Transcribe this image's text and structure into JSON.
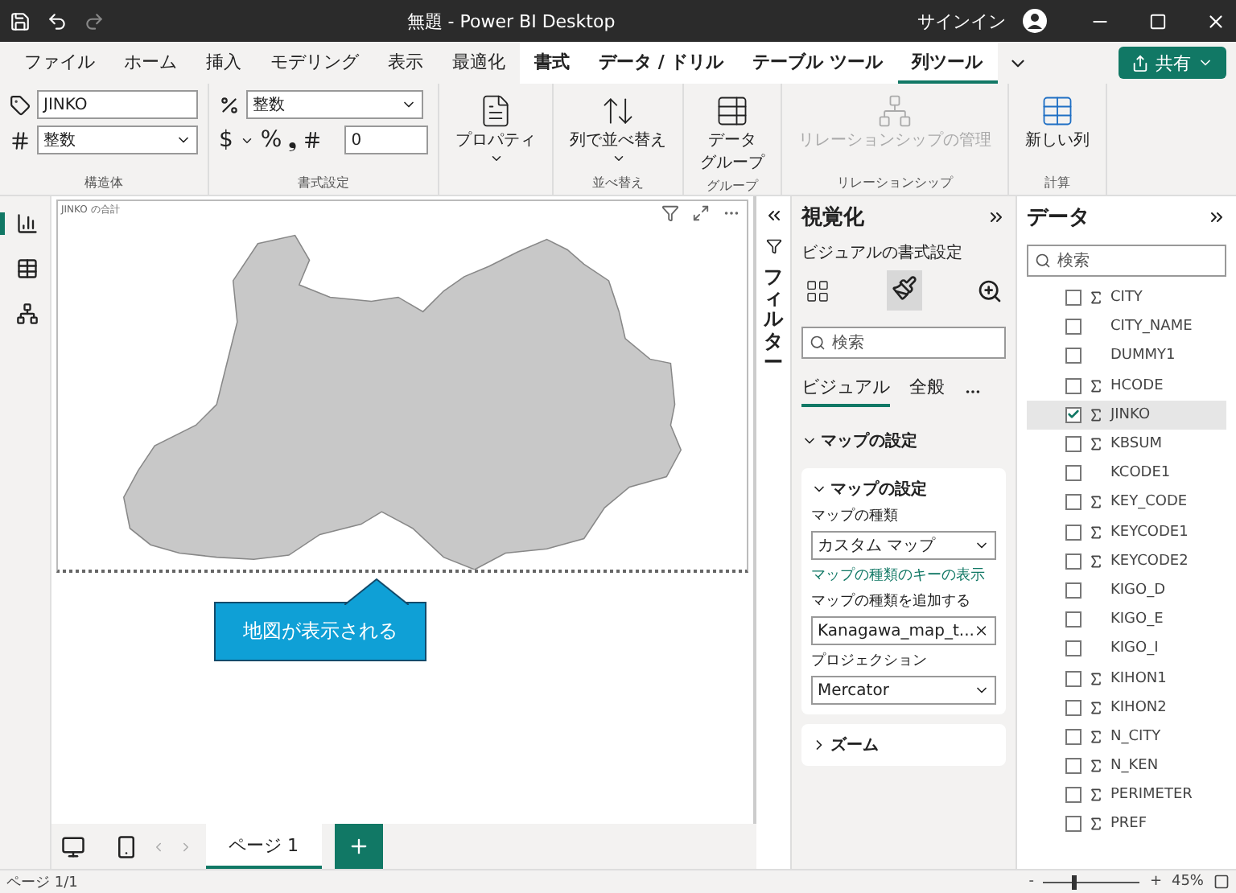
{
  "window": {
    "title": "無題 - Power BI Desktop",
    "signin": "サインイン"
  },
  "ribbon_tabs": [
    {
      "label": "ファイル",
      "selected": false,
      "contextual": false
    },
    {
      "label": "ホーム",
      "selected": false,
      "contextual": false
    },
    {
      "label": "挿入",
      "selected": false,
      "contextual": false
    },
    {
      "label": "モデリング",
      "selected": false,
      "contextual": false
    },
    {
      "label": "表示",
      "selected": false,
      "contextual": false
    },
    {
      "label": "最適化",
      "selected": false,
      "contextual": false
    },
    {
      "label": "書式",
      "selected": false,
      "contextual": true
    },
    {
      "label": "データ / ドリル",
      "selected": false,
      "contextual": true
    },
    {
      "label": "テーブル ツール",
      "selected": false,
      "contextual": true
    },
    {
      "label": "列ツール",
      "selected": true,
      "contextual": true
    }
  ],
  "share_button": "共有",
  "ribbon": {
    "structure": {
      "name": "JINKO",
      "data_type": "整数",
      "label": "構造体"
    },
    "format": {
      "format": "整数",
      "currency": "$",
      "percent": "%",
      "comma": "❟",
      "decimals": "0",
      "label": "書式設定"
    },
    "properties": {
      "label": "プロパティ"
    },
    "sort": {
      "button": "列で並べ替え",
      "label": "並べ替え"
    },
    "groups": {
      "button_line1": "データ",
      "button_line2": "グループ",
      "label": "グループ"
    },
    "relations": {
      "button": "リレーションシップの管理",
      "label": "リレーションシップ",
      "disabled": true
    },
    "calc": {
      "button": "新しい列",
      "label": "計算"
    }
  },
  "visual": {
    "title": "JINKO の合計",
    "callout": "地図が表示される"
  },
  "page_tabs": [
    {
      "label": "ページ 1",
      "selected": true
    }
  ],
  "filters": {
    "label": "フィルター"
  },
  "visualizations": {
    "title": "視覚化",
    "subtitle": "ビジュアルの書式設定",
    "search_placeholder": "検索",
    "tabs": [
      {
        "label": "ビジュアル",
        "selected": true
      },
      {
        "label": "全般",
        "selected": false
      }
    ],
    "section": "マップの設定",
    "card": {
      "title": "マップの設定",
      "expanded": true,
      "map_type_label": "マップの種類",
      "map_type": "カスタム マップ",
      "link": "マップの種類のキーの表示",
      "add_label": "マップの種類を追加する",
      "file": "Kanagawa_map_t...",
      "projection_label": "プロジェクション",
      "projection": "Mercator"
    },
    "zoom_card": {
      "title": "ズーム",
      "expanded": false
    }
  },
  "data": {
    "title": "データ",
    "search_placeholder": "検索",
    "fields": [
      {
        "name": "CITY",
        "sum": true,
        "checked": false
      },
      {
        "name": "CITY_NAME",
        "sum": false,
        "checked": false
      },
      {
        "name": "DUMMY1",
        "sum": false,
        "checked": false
      },
      {
        "name": "HCODE",
        "sum": true,
        "checked": false
      },
      {
        "name": "JINKO",
        "sum": true,
        "checked": true
      },
      {
        "name": "KBSUM",
        "sum": true,
        "checked": false
      },
      {
        "name": "KCODE1",
        "sum": false,
        "checked": false
      },
      {
        "name": "KEY_CODE",
        "sum": true,
        "checked": false
      },
      {
        "name": "KEYCODE1",
        "sum": true,
        "checked": false
      },
      {
        "name": "KEYCODE2",
        "sum": true,
        "checked": false
      },
      {
        "name": "KIGO_D",
        "sum": false,
        "checked": false
      },
      {
        "name": "KIGO_E",
        "sum": false,
        "checked": false
      },
      {
        "name": "KIGO_I",
        "sum": false,
        "checked": false
      },
      {
        "name": "KIHON1",
        "sum": true,
        "checked": false
      },
      {
        "name": "KIHON2",
        "sum": true,
        "checked": false
      },
      {
        "name": "N_CITY",
        "sum": true,
        "checked": false
      },
      {
        "name": "N_KEN",
        "sum": true,
        "checked": false
      },
      {
        "name": "PERIMETER",
        "sum": true,
        "checked": false
      },
      {
        "name": "PREF",
        "sum": true,
        "checked": false
      }
    ]
  },
  "status_bar": {
    "page": "ページ 1/1",
    "zoom_minus": "-",
    "zoom_plus": "+",
    "zoom": "45%",
    "zoom_slider": {
      "level": 0.3
    }
  }
}
